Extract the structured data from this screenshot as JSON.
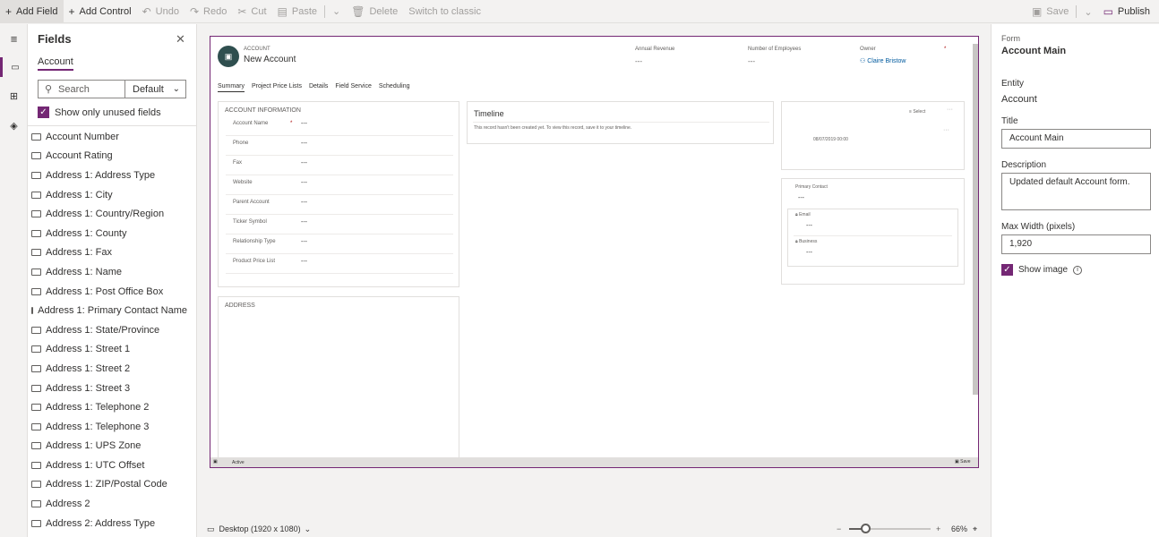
{
  "toolbar": {
    "add_field": "Add Field",
    "add_control": "Add Control",
    "undo": "Undo",
    "redo": "Redo",
    "cut": "Cut",
    "paste": "Paste",
    "delete": "Delete",
    "switch_classic": "Switch to classic",
    "save": "Save",
    "publish": "Publish"
  },
  "fields_panel": {
    "title": "Fields",
    "tab": "Account",
    "search_placeholder": "Search",
    "filter_value": "Default",
    "show_unused_label": "Show only unused fields",
    "show_unused_checked": true,
    "items": [
      "Account Number",
      "Account Rating",
      "Address 1: Address Type",
      "Address 1: City",
      "Address 1: Country/Region",
      "Address 1: County",
      "Address 1: Fax",
      "Address 1: Name",
      "Address 1: Post Office Box",
      "Address 1: Primary Contact Name",
      "Address 1: State/Province",
      "Address 1: Street 1",
      "Address 1: Street 2",
      "Address 1: Street 3",
      "Address 1: Telephone 2",
      "Address 1: Telephone 3",
      "Address 1: UPS Zone",
      "Address 1: UTC Offset",
      "Address 1: ZIP/Postal Code",
      "Address 2",
      "Address 2: Address Type"
    ]
  },
  "form": {
    "entity_label": "ACCOUNT",
    "record_name": "New Account",
    "header_fields": [
      {
        "label": "Annual Revenue",
        "value": "---"
      },
      {
        "label": "Number of Employees",
        "value": "---"
      },
      {
        "label": "Owner",
        "value": "Claire Bristow"
      }
    ],
    "tabs": [
      "Summary",
      "Project Price Lists",
      "Details",
      "Field Service",
      "Scheduling"
    ],
    "account_info": {
      "title": "ACCOUNT INFORMATION",
      "rows": [
        {
          "label": "Account Name",
          "value": "---"
        },
        {
          "label": "Phone",
          "value": "---"
        },
        {
          "label": "Fax",
          "value": "---"
        },
        {
          "label": "Website",
          "value": "---"
        },
        {
          "label": "Parent Account",
          "value": "---"
        },
        {
          "label": "Ticker Symbol",
          "value": "---"
        },
        {
          "label": "Relationship Type",
          "value": "---"
        },
        {
          "label": "Product Price List",
          "value": "---"
        }
      ]
    },
    "address_title": "ADDRESS",
    "timeline": {
      "title": "Timeline",
      "message": "This record hasn't been created yet.  To view this record, save it to your timeline."
    },
    "right_card": {
      "select_label": "Select",
      "date": "08/07/2019 00:00"
    },
    "contact_card": {
      "primary_contact_label": "Primary Contact",
      "primary_contact_value": "---",
      "email_label": "Email",
      "email_value": "---",
      "business_label": "Business",
      "business_value": "---"
    },
    "status": "Active",
    "save_label": "Save"
  },
  "bottom_bar": {
    "device": "Desktop (1920 x 1080)",
    "zoom": "66%",
    "zoom_level": 0.2
  },
  "properties": {
    "section": "Form",
    "form_name": "Account Main",
    "entity_label": "Entity",
    "entity_value": "Account",
    "title_label": "Title",
    "title_value": "Account Main",
    "description_label": "Description",
    "description_value": "Updated default Account form.",
    "max_width_label": "Max Width (pixels)",
    "max_width_value": "1,920",
    "show_image_label": "Show image",
    "show_image_checked": true
  },
  "colors": {
    "accent": "#742774",
    "link": "#005a9e"
  }
}
